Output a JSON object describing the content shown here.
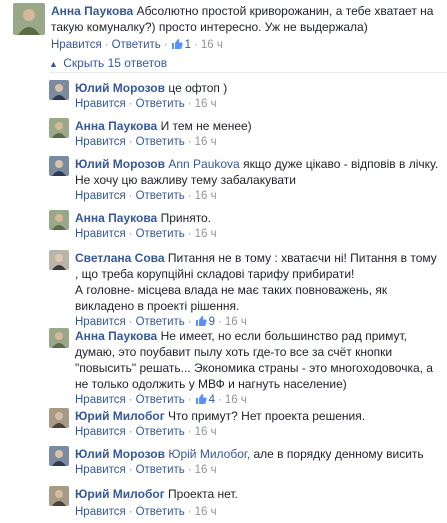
{
  "actions": {
    "like": "Нравится",
    "reply": "Ответить",
    "dot": "·"
  },
  "hide_replies_label": "Скрыть 15 ответов",
  "comments": [
    {
      "author": "Анна Паукова",
      "mention": "",
      "text": "Абсолютно простой криворожанин, а тебе хватает на такую комуналку?) просто интересно. Уж не выдержала)",
      "likes": "1",
      "time": "16 ч"
    },
    {
      "author": "Юлий Морозов",
      "mention": "",
      "text": "це офтоп )",
      "likes": "",
      "time": "16 ч"
    },
    {
      "author": "Анна Паукова",
      "mention": "",
      "text": "И тем не менее)",
      "likes": "",
      "time": "16 ч"
    },
    {
      "author": "Юлий Морозов",
      "mention": "Ann Paukova",
      "text": "якщо дуже цікаво - відповів в лічку. Не хочу цю важливу тему забалакувати",
      "likes": "",
      "time": "16 ч"
    },
    {
      "author": "Анна Паукова",
      "mention": "",
      "text": "Принято.",
      "likes": "",
      "time": "16 ч"
    },
    {
      "author": "Светлана Сова",
      "mention": "",
      "text": "Питання не в тому : хватаєчи ні! Питання в тому , що треба корупційні складові тарифу прибирати!\nА головне- місцева влада не має таких повноважень, як викладено в проекті рішення.",
      "likes": "9",
      "time": "16 ч"
    },
    {
      "author": "Анна Паукова",
      "mention": "",
      "text": "Не имеет, но если большинство рад примут, думаю, это поубавит пылу хоть где-то все за счёт кнопки \"повысить\" решать... Экономика страны - это многоходовочка, а не только одолжить у МВФ и нагнуть население)",
      "likes": "4",
      "time": "16 ч"
    },
    {
      "author": "Юрий Милобог",
      "mention": "",
      "text": "Что примут? Нет проекта решения.",
      "likes": "",
      "time": "16 ч"
    },
    {
      "author": "Юлий Морозов",
      "mention": "Юрій Милобог,",
      "text": "але в порядку денному висить",
      "likes": "",
      "time": "16 ч"
    },
    {
      "author": "Юрий Милобог",
      "mention": "",
      "text": "Проекта нет.",
      "likes": "",
      "time": "16 ч"
    }
  ]
}
